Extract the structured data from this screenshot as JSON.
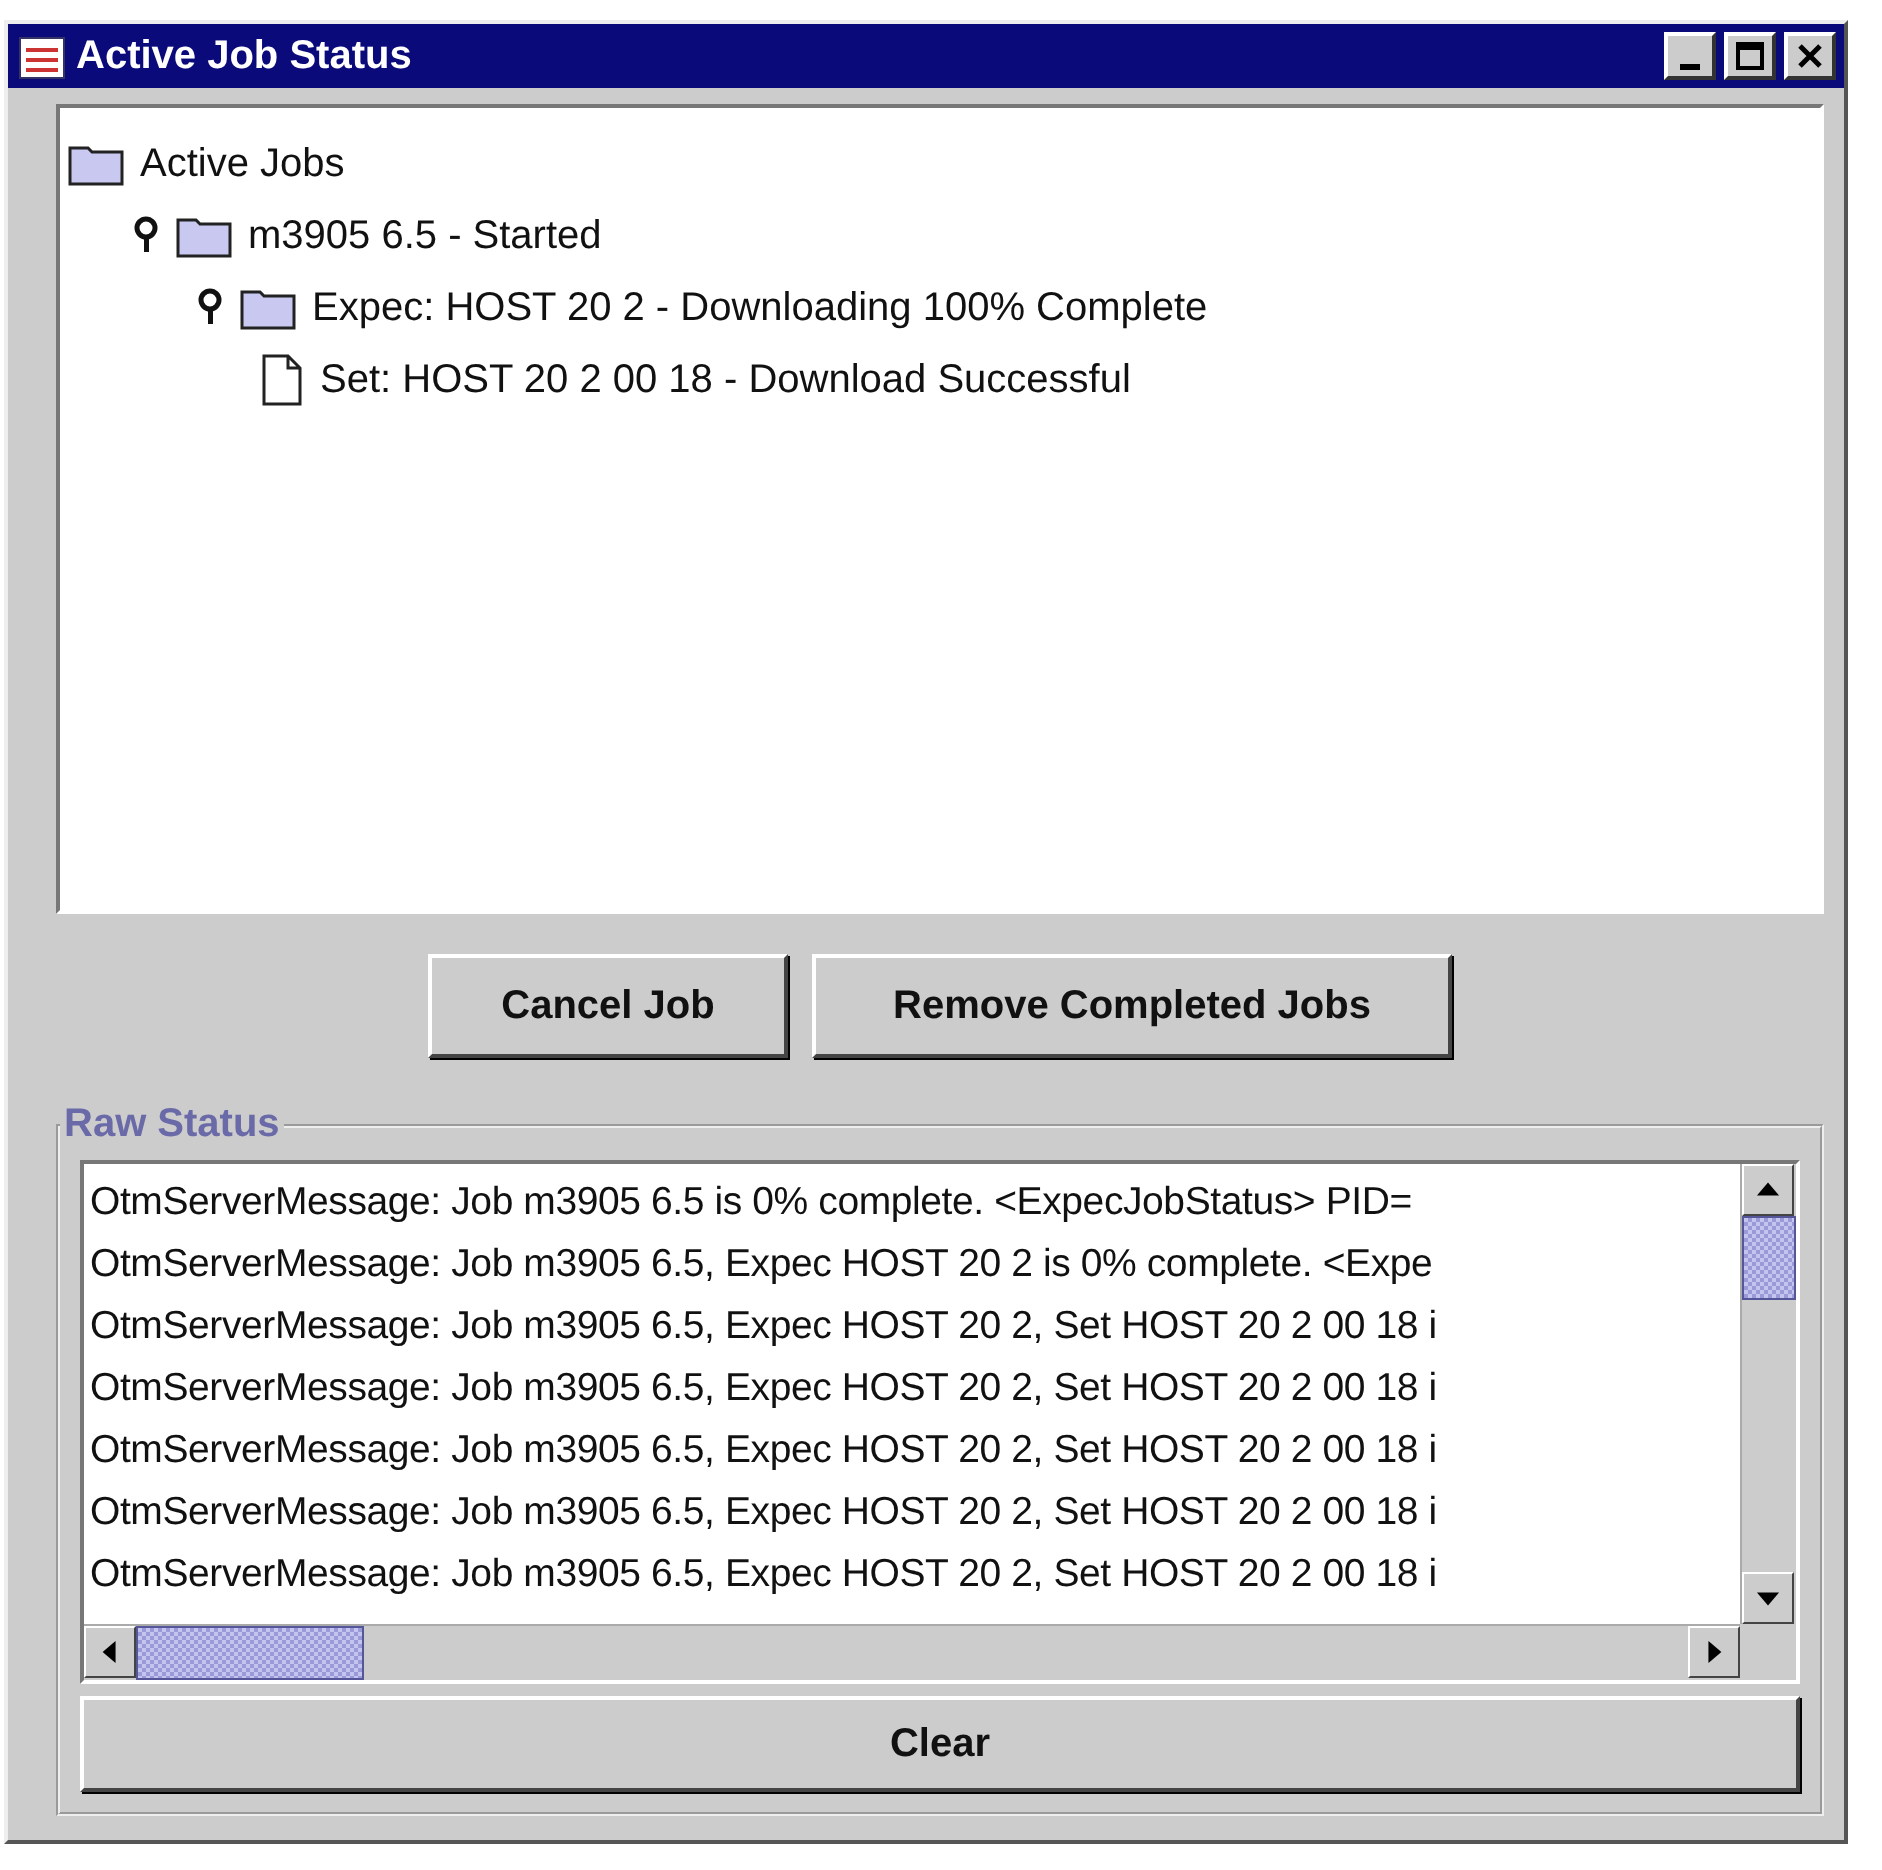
{
  "window": {
    "title": "Active Job Status"
  },
  "tree": [
    {
      "label": "Active Jobs",
      "kind": "folder",
      "children": [
        {
          "label": "m3905 6.5 - Started",
          "kind": "folder",
          "expanded": true,
          "children": [
            {
              "label": "Expec: HOST 20 2 - Downloading 100% Complete",
              "kind": "folder",
              "expanded": true,
              "children": [
                {
                  "label": "Set: HOST 20 2 00 18 - Download Successful",
                  "kind": "file"
                }
              ]
            }
          ]
        }
      ]
    }
  ],
  "buttons": [
    "Cancel Job",
    "Remove Completed Jobs"
  ],
  "raw_status": {
    "title": "Raw Status",
    "lines": [
      "OtmServerMessage: Job m3905 6.5 is 0% complete. <ExpecJobStatus> PID=",
      "OtmServerMessage: Job m3905 6.5, Expec HOST 20 2 is 0% complete. <Expe",
      "OtmServerMessage: Job m3905 6.5, Expec HOST 20 2, Set HOST 20 2 00 18 i",
      "OtmServerMessage: Job m3905 6.5, Expec HOST 20 2, Set HOST 20 2 00 18 i",
      "OtmServerMessage: Job m3905 6.5, Expec HOST 20 2, Set HOST 20 2 00 18 i",
      "OtmServerMessage: Job m3905 6.5, Expec HOST 20 2, Set HOST 20 2 00 18 i",
      "OtmServerMessage: Job m3905 6.5, Expec HOST 20 2, Set HOST 20 2 00 18 i"
    ],
    "clear_button": "Clear"
  }
}
